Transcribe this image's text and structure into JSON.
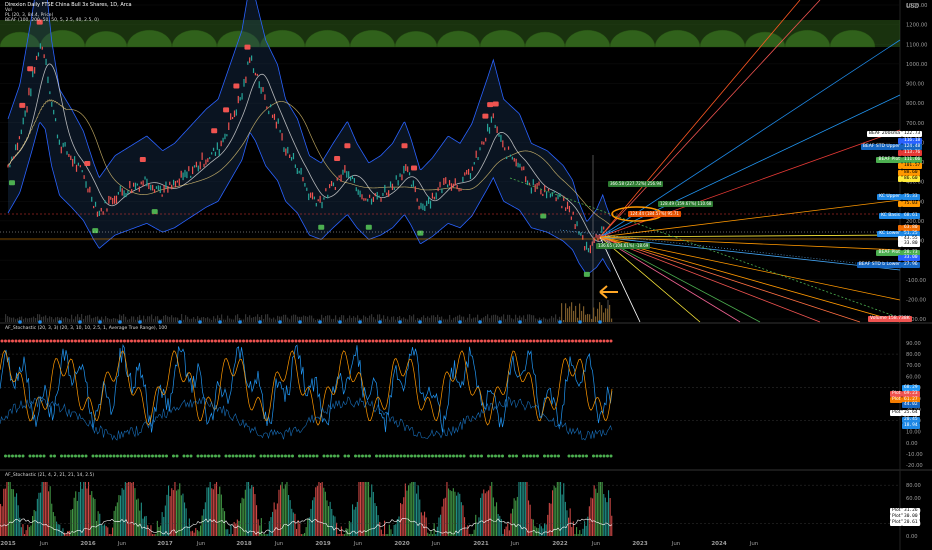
{
  "header": {
    "title": "Direxion Daily FTSE China Bull 3x Shares, 1D, Arca",
    "line2": "Vol",
    "line3": "PL (20, 3, 84.4, Price)",
    "line4": "BEAF (100, 200, 50, 50, 5, 2.5, 40, 2.5, 0)",
    "pane2_title": "AF_Stochastic (20, 3, 3) (20, 3, 10, 10, 2.5, 1, Average True Range), 100",
    "pane3_title": "AF_Stochastic (21, 4, 2, 21, 21, 14, 2.5)"
  },
  "currency": "USD",
  "price_axis": [
    {
      "label": "1300.00",
      "v": 1300
    },
    {
      "label": "1200.00",
      "v": 1200
    },
    {
      "label": "1100.00",
      "v": 1100
    },
    {
      "label": "1000.00",
      "v": 1000
    },
    {
      "label": "900.00",
      "v": 900
    },
    {
      "label": "800.00",
      "v": 800
    },
    {
      "label": "700.00",
      "v": 700
    },
    {
      "label": "600.00",
      "v": 600
    },
    {
      "label": "500.00",
      "v": 500
    },
    {
      "label": "400.00",
      "v": 400
    },
    {
      "label": "300.00",
      "v": 300
    },
    {
      "label": "200.00",
      "v": 200
    },
    {
      "label": "100.00",
      "v": 100
    },
    {
      "label": "0.00",
      "v": 0
    },
    {
      "label": "-100.00",
      "v": -100
    },
    {
      "label": "-200.00",
      "v": -200
    },
    {
      "label": "-300.00",
      "v": -300
    }
  ],
  "osc1_axis": [
    {
      "label": "90.00",
      "v": 90
    },
    {
      "label": "80.00",
      "v": 80
    },
    {
      "label": "70.00",
      "v": 70
    },
    {
      "label": "60.00",
      "v": 60
    },
    {
      "label": "50.00",
      "v": 50
    },
    {
      "label": "40.00",
      "v": 40
    },
    {
      "label": "30.00",
      "v": 30
    },
    {
      "label": "20.00",
      "v": 20
    },
    {
      "label": "10.00",
      "v": 10
    },
    {
      "label": "0.00",
      "v": 0
    },
    {
      "label": "-10.00",
      "v": -10
    },
    {
      "label": "-20.00",
      "v": -20
    }
  ],
  "osc2_axis": [
    {
      "label": "80.00",
      "v": 80
    },
    {
      "label": "60.00",
      "v": 60
    },
    {
      "label": "40.00",
      "v": 40
    },
    {
      "label": "20.00",
      "v": 20
    },
    {
      "label": "0.00",
      "v": 0
    }
  ],
  "time_axis": [
    "2015",
    "Jun",
    "2016",
    "Jun",
    "2017",
    "Jun",
    "2018",
    "Jun",
    "2019",
    "Jun",
    "2020",
    "Jun",
    "2021",
    "Jun",
    "2022",
    "Jun",
    "2023",
    "Jun",
    "2024",
    "Jun"
  ],
  "price_tags": [
    {
      "text": "BEAF 200sma",
      "value": "122.73",
      "color": "#ffffff",
      "fg": "#000000"
    },
    {
      "text": "",
      "value": "116.18",
      "color": "#2962ff",
      "fg": "#ffffff"
    },
    {
      "text": "BEAF STD Upper",
      "value": "124.48",
      "color": "#1565c0",
      "fg": "#ffffff"
    },
    {
      "text": "",
      "value": "113.76",
      "color": "#e53935",
      "fg": "#ffffff"
    },
    {
      "text": "BEAF Plot",
      "value": "111.66",
      "color": "#4caf50",
      "fg": "#ffffff"
    },
    {
      "text": "",
      "value": "101.57",
      "color": "#ff9800",
      "fg": "#000000"
    },
    {
      "text": "",
      "value": "88.60",
      "color": "#ff9800",
      "fg": "#000000"
    },
    {
      "text": "",
      "value": "86.60",
      "color": "#ffeb3b",
      "fg": "#000000"
    },
    {
      "text": "KC Upper",
      "value": "75.33",
      "color": "#1e88e5",
      "fg": "#ffffff"
    },
    {
      "text": "",
      "value": "75.03",
      "color": "#ff9800",
      "fg": "#000000"
    },
    {
      "text": "KC Basis",
      "value": "68.61",
      "color": "#1e88e5",
      "fg": "#ffffff"
    },
    {
      "text": "",
      "value": "63.80",
      "color": "#ef6c00",
      "fg": "#ffffff"
    },
    {
      "text": "KC Lower",
      "value": "51.25",
      "color": "#1e88e5",
      "fg": "#ffffff"
    },
    {
      "text": "",
      "value": "43.55",
      "color": "#ffffff",
      "fg": "#000000"
    },
    {
      "text": "",
      "value": "33.80",
      "color": "#ffffff",
      "fg": "#000000"
    },
    {
      "text": "BEAF Plot",
      "value": "28.73",
      "color": "#4caf50",
      "fg": "#ffffff"
    },
    {
      "text": "",
      "value": "33.00",
      "color": "#2962ff",
      "fg": "#ffffff"
    },
    {
      "text": "BEAF STD b Lower",
      "value": "27.96",
      "color": "#1565c0",
      "fg": "#ffffff"
    }
  ],
  "volume_tag": {
    "text": "Volume",
    "value": "158.738K"
  },
  "osc1_tags": [
    {
      "text": "",
      "value": "68.29",
      "color": "#2196f3"
    },
    {
      "text": "Plot",
      "value": "69.23",
      "color": "#ef5350"
    },
    {
      "text": "Plot",
      "value": "61.27",
      "color": "#f57c00"
    },
    {
      "text": "",
      "value": "44.02",
      "color": "#1565c0"
    },
    {
      "text": "Plot",
      "value": "25.64",
      "color": "#ffffff"
    },
    {
      "text": "",
      "value": "20.45",
      "color": "#1e88e5"
    },
    {
      "text": "",
      "value": "18.94",
      "color": "#1e88e5"
    }
  ],
  "osc2_tags": [
    {
      "text": "Plot",
      "value": "31.26",
      "color": "#ffffff"
    },
    {
      "text": "Plot",
      "value": "30.00",
      "color": "#ffffff"
    },
    {
      "text": "Plot",
      "value": "20.61",
      "color": "#ffffff"
    }
  ],
  "annotations": [
    {
      "text": "366.58 (227.72%) 256.94",
      "color": "#2e7d32"
    },
    {
      "text": "128.49 (159.67%) 110.68",
      "color": "#2e7d32"
    },
    {
      "text": "124.44 (184.57%) 95.71",
      "color": "#e65100"
    },
    {
      "text": "136.65 (104.61%) -18.69",
      "color": "#2e7d32"
    }
  ],
  "chart_data": [
    {
      "type": "line",
      "title": "Direxion Daily FTSE China Bull 3x Shares, 1D, Arca",
      "ylabel": "USD",
      "ylim": [
        -300,
        1300
      ],
      "x": [
        "2015-01",
        "2015-04",
        "2015-06",
        "2015-09",
        "2015-12",
        "2016-02",
        "2016-06",
        "2016-10",
        "2017-01",
        "2017-06",
        "2017-10",
        "2018-01",
        "2018-03",
        "2018-06",
        "2018-10",
        "2019-01",
        "2019-04",
        "2019-08",
        "2020-01",
        "2020-03",
        "2020-07",
        "2020-10",
        "2021-02",
        "2021-06",
        "2021-10",
        "2022-01",
        "2022-03",
        "2022-05",
        "2022-07"
      ],
      "series": [
        {
          "values": [
            500,
            800,
            1100,
            720,
            500,
            300,
            360,
            380,
            450,
            600,
            800,
            1000,
            900,
            650,
            320,
            280,
            480,
            320,
            420,
            260,
            380,
            420,
            730,
            480,
            330,
            260,
            150,
            90,
            110
          ]
        }
      ]
    },
    {
      "type": "line",
      "title": "AF_Stochastic (20, 3, 3) (20, 3, 10, 10, 2.5, 1, Average True Range), 100",
      "ylim": [
        -20,
        95
      ],
      "x": [
        "2015",
        "2016",
        "2017",
        "2018",
        "2019",
        "2020",
        "2021",
        "2022"
      ],
      "series": [
        {
          "values": [
            50,
            45,
            60,
            55,
            48,
            52,
            58,
            40
          ]
        }
      ]
    },
    {
      "type": "bar",
      "title": "AF_Stochastic (21, 4, 2, 21, 21, 14, 2.5)",
      "ylim": [
        0,
        95
      ],
      "x": [
        "2015",
        "2016",
        "2017",
        "2018",
        "2019",
        "2020",
        "2021",
        "2022"
      ],
      "series": [
        {
          "values": [
            60,
            55,
            70,
            65,
            50,
            58,
            66,
            31.26
          ]
        }
      ]
    }
  ]
}
